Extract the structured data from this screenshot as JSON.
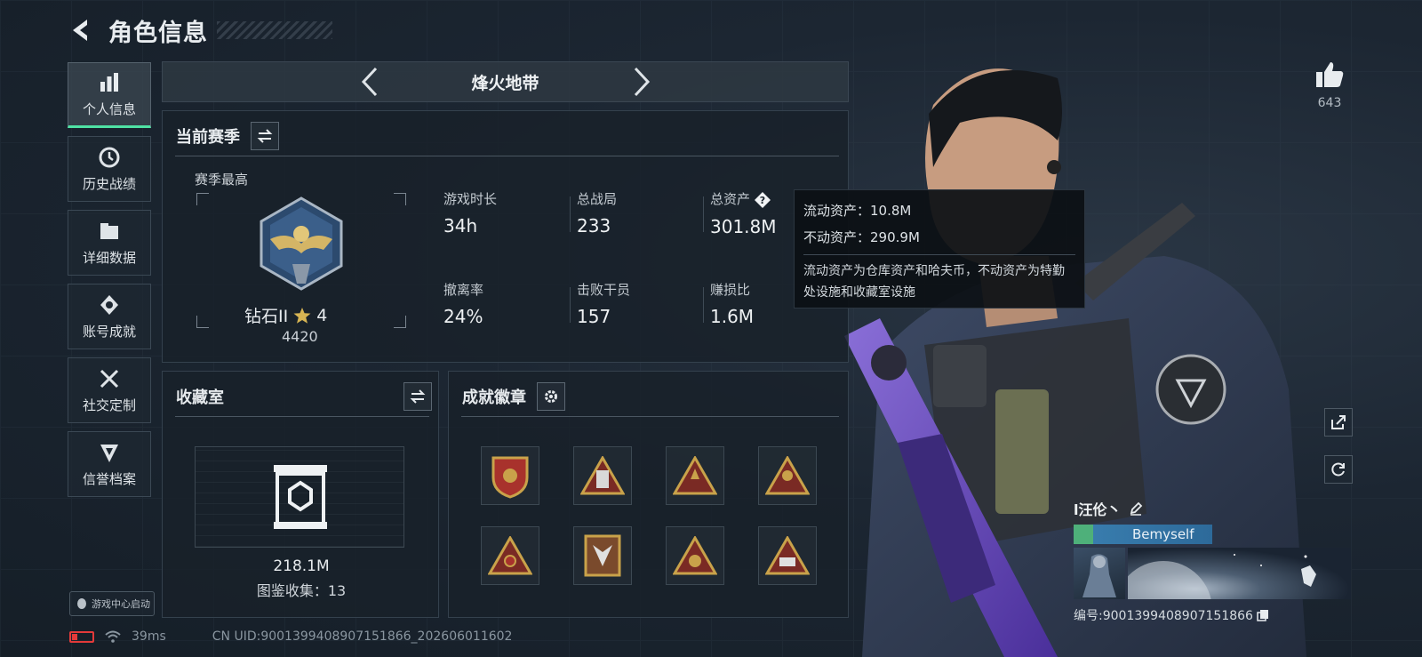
{
  "header": {
    "title": "角色信息"
  },
  "sidebar": {
    "items": [
      {
        "label": "个人信息",
        "icon": "bar-chart-icon",
        "active": true
      },
      {
        "label": "历史战绩",
        "icon": "clock-icon"
      },
      {
        "label": "详细数据",
        "icon": "folder-icon"
      },
      {
        "label": "账号成就",
        "icon": "medal-icon"
      },
      {
        "label": "社交定制",
        "icon": "tools-icon"
      },
      {
        "label": "信誉档案",
        "icon": "shield-icon"
      }
    ]
  },
  "launcher": {
    "label": "游戏中心启动"
  },
  "status": {
    "ping": "39ms",
    "uid": "CN UID:9001399408907151866_202606011602",
    "battery_color": "#e33a3a"
  },
  "mode": {
    "title": "烽火地带"
  },
  "season": {
    "title": "当前赛季",
    "rank_label": "赛季最高",
    "rank_name": "钻石II",
    "rank_stars": "4",
    "rank_score": "4420",
    "stats": [
      {
        "label": "游戏时长",
        "value": "34h"
      },
      {
        "label": "总战局",
        "value": "233"
      },
      {
        "label": "总资产",
        "value": "301.8M"
      },
      {
        "label": "撤离率",
        "value": "24%"
      },
      {
        "label": "击败干员",
        "value": "157"
      },
      {
        "label": "赚损比",
        "value": "1.6M"
      }
    ]
  },
  "tooltip": {
    "liquid": "流动资产：10.8M",
    "fixed": "不动资产：290.9M",
    "desc": "流动资产为仓库资产和哈夫币，不动资产为特勤处设施和收藏室设施"
  },
  "collection": {
    "title": "收藏室",
    "value": "218.1M",
    "count": "图鉴收集：13"
  },
  "badges": {
    "title": "成就徽章"
  },
  "social": {
    "likes": "643"
  },
  "player": {
    "name": "l汪伦丶",
    "tag": "Bemyself",
    "id": "编号:9001399408907151866"
  },
  "colors": {
    "accent": "#4fe2a4",
    "panel_bg": "#18212a",
    "gold": "#c9a24a"
  }
}
